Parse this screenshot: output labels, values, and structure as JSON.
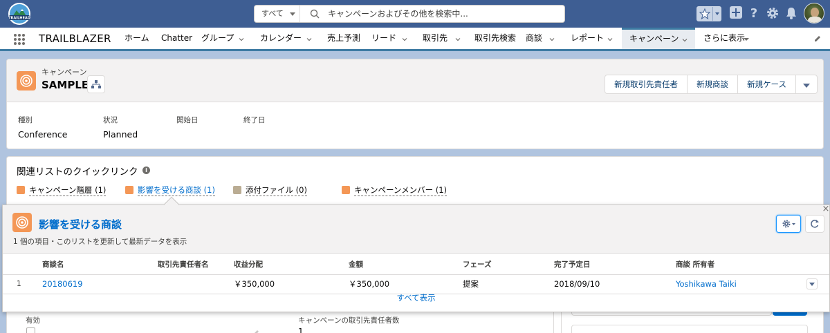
{
  "global_header": {
    "logo_text": "TRAILHEAD",
    "search": {
      "scope": "すべて",
      "placeholder": "キャンペーンおよびその他を検索中..."
    }
  },
  "nav": {
    "app_name": "TRAILBLAZER",
    "items": [
      {
        "label": "ホーム"
      },
      {
        "label": "Chatter"
      },
      {
        "label": "グループ"
      },
      {
        "label": "カレンダー"
      },
      {
        "label": "売上予測"
      },
      {
        "label": "リード"
      },
      {
        "label": "取引先"
      },
      {
        "label": "取引先検索"
      },
      {
        "label": "商談"
      },
      {
        "label": "レポート"
      },
      {
        "label": "キャンペーン"
      },
      {
        "label": "さらに表示"
      }
    ]
  },
  "record": {
    "object_type": "キャンペーン",
    "title": "SAMPLE",
    "actions": [
      "新規取引先責任者",
      "新規商談",
      "新規ケース"
    ],
    "fields": [
      {
        "label": "種別",
        "value": "Conference"
      },
      {
        "label": "状況",
        "value": "Planned"
      },
      {
        "label": "開始日",
        "value": ""
      },
      {
        "label": "終了日",
        "value": ""
      }
    ]
  },
  "quick_links": {
    "title": "関連リストのクイックリンク",
    "info_icon": "i",
    "links": [
      {
        "label": "キャンペーン階層 (1)",
        "color": "#f49756"
      },
      {
        "label": "影響を受ける商談 (1)",
        "color": "#f49756"
      },
      {
        "label": "添付ファイル (0)",
        "color": "#baac93"
      },
      {
        "label": "キャンペーンメンバー (1)",
        "color": "#f49756"
      }
    ]
  },
  "popover": {
    "title": "影響を受ける商談",
    "subtitle": "1 個の項目・このリストを更新して最新データを表示",
    "close": "×",
    "columns": [
      "商談名",
      "取引先責任者名",
      "収益分配",
      "金額",
      "フェーズ",
      "完了予定日",
      "商談 所有者"
    ],
    "rows": [
      {
        "num": "1",
        "name": "20180619",
        "contact": "",
        "revenue_share": "￥350,000",
        "amount": "￥350,000",
        "phase": "提案",
        "close_date": "2018/09/10",
        "owner": "Yoshikawa Taiki"
      }
    ],
    "view_all": "すべて表示"
  },
  "lower": {
    "left_label_1": "有効",
    "left_label_2": "キャンペーンの取引先責任者数",
    "left_value_2": "1"
  },
  "colors": {
    "header": "#3e5e93",
    "accent": "#f49756",
    "link": "#006dcc",
    "nav_active": "#3e7ba3"
  }
}
